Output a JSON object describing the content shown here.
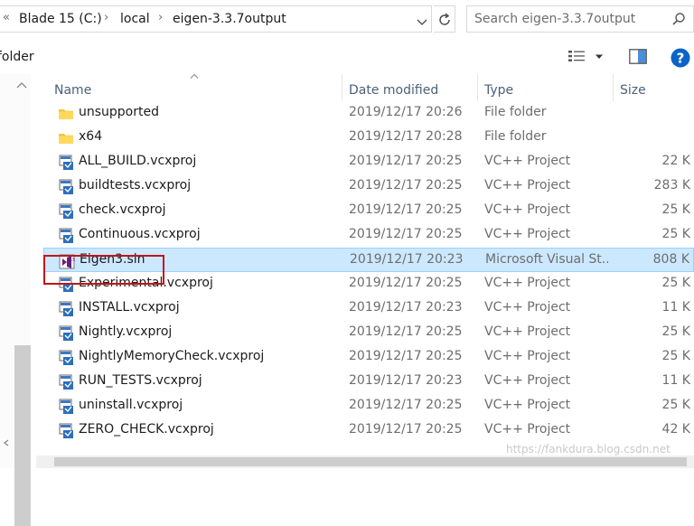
{
  "address": {
    "back_chevron": "«",
    "crumbs": [
      "Blade 15 (C:)",
      "local",
      "eigen-3.3.7output"
    ],
    "separator": "›"
  },
  "search": {
    "placeholder": "Search eigen-3.3.7output"
  },
  "toolbar": {
    "new_folder_label": "folder"
  },
  "columns": {
    "name": "Name",
    "date": "Date modified",
    "type": "Type",
    "size": "Size"
  },
  "files": [
    {
      "icon": "folder-icon",
      "name": "unsupported",
      "date": "2019/12/17 20:26",
      "type": "File folder",
      "size": ""
    },
    {
      "icon": "folder-icon",
      "name": "x64",
      "date": "2019/12/17 20:28",
      "type": "File folder",
      "size": ""
    },
    {
      "icon": "vcxproj-icon",
      "name": "ALL_BUILD.vcxproj",
      "date": "2019/12/17 20:25",
      "type": "VC++ Project",
      "size": "22 K"
    },
    {
      "icon": "vcxproj-icon",
      "name": "buildtests.vcxproj",
      "date": "2019/12/17 20:25",
      "type": "VC++ Project",
      "size": "283 K"
    },
    {
      "icon": "vcxproj-icon",
      "name": "check.vcxproj",
      "date": "2019/12/17 20:25",
      "type": "VC++ Project",
      "size": "25 K"
    },
    {
      "icon": "vcxproj-icon",
      "name": "Continuous.vcxproj",
      "date": "2019/12/17 20:25",
      "type": "VC++ Project",
      "size": "25 K"
    },
    {
      "icon": "sln-icon",
      "name": "Eigen3.sln",
      "date": "2019/12/17 20:23",
      "type": "Microsoft Visual St...",
      "size": "808 K",
      "selected": true
    },
    {
      "icon": "vcxproj-icon",
      "name": "Experimental.vcxproj",
      "date": "2019/12/17 20:25",
      "type": "VC++ Project",
      "size": "25 K"
    },
    {
      "icon": "vcxproj-icon",
      "name": "INSTALL.vcxproj",
      "date": "2019/12/17 20:23",
      "type": "VC++ Project",
      "size": "11 K"
    },
    {
      "icon": "vcxproj-icon",
      "name": "Nightly.vcxproj",
      "date": "2019/12/17 20:25",
      "type": "VC++ Project",
      "size": "25 K"
    },
    {
      "icon": "vcxproj-icon",
      "name": "NightlyMemoryCheck.vcxproj",
      "date": "2019/12/17 20:25",
      "type": "VC++ Project",
      "size": "25 K"
    },
    {
      "icon": "vcxproj-icon",
      "name": "RUN_TESTS.vcxproj",
      "date": "2019/12/17 20:23",
      "type": "VC++ Project",
      "size": "11 K"
    },
    {
      "icon": "vcxproj-icon",
      "name": "uninstall.vcxproj",
      "date": "2019/12/17 20:25",
      "type": "VC++ Project",
      "size": "25 K"
    },
    {
      "icon": "vcxproj-icon",
      "name": "ZERO_CHECK.vcxproj",
      "date": "2019/12/17 20:25",
      "type": "VC++ Project",
      "size": "42 K"
    }
  ],
  "watermark": "https://fankdura.blog.csdn.net",
  "colors": {
    "selection": "#cce8ff",
    "selection_border": "#99d1ff",
    "annotation": "#c3141b",
    "help": "#0a64c8"
  }
}
